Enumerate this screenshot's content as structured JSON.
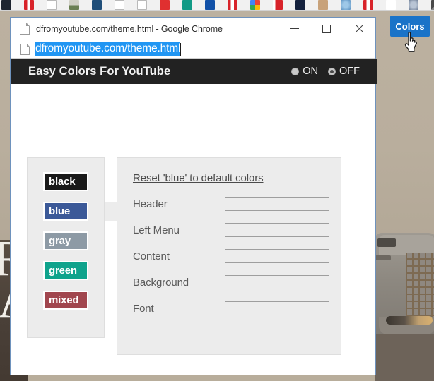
{
  "desktop": {
    "bookmark_favicons": [
      "bookmark-favicon-dark",
      "bookmark-favicon-red-stripes",
      "bookmark-favicon-blank",
      "bookmark-favicon-photo",
      "bookmark-favicon-blue-building",
      "bookmark-favicon-blank-2",
      "bookmark-favicon-blank-3",
      "bookmark-favicon-red-rounded",
      "bookmark-favicon-teal-check",
      "bookmark-favicon-blue-flag",
      "bookmark-favicon-red-stripes-2",
      "bookmark-favicon-google-maps",
      "bookmark-favicon-red-white",
      "bookmark-favicon-navy",
      "bookmark-favicon-hand",
      "bookmark-favicon-blue-circle",
      "bookmark-favicon-red-stripes-3",
      "bookmark-favicon-white-text",
      "bookmark-favicon-globe",
      "bookmark-favicon-bird",
      "bookmark-favicon-brown",
      "bookmark-favicon-black"
    ]
  },
  "browser": {
    "window_title": "dfromyoutube.com/theme.html - Google Chrome",
    "url": "dfromyoutube.com/theme.html",
    "tab_favicon": "page-icon",
    "controls": {
      "minimize": "minimize-icon",
      "maximize": "maximize-icon",
      "close": "close-icon"
    }
  },
  "extension": {
    "title": "Easy Colors For YouTube",
    "power": {
      "on_label": "ON",
      "off_label": "OFF",
      "selected": "OFF"
    },
    "presets": [
      {
        "label": "black",
        "bg": "#1a1a1a",
        "fg": "#ffffff",
        "selected": false
      },
      {
        "label": "blue",
        "bg": "#3b5998",
        "fg": "#ffffff",
        "selected": true
      },
      {
        "label": "gray",
        "bg": "#8d9aa5",
        "fg": "#ffffff",
        "selected": false
      },
      {
        "label": "green",
        "bg": "#0fa38c",
        "fg": "#ffffff",
        "selected": false
      },
      {
        "label": "mixed",
        "bg": "#a1464e",
        "fg": "#ffffff",
        "selected": false
      }
    ],
    "reset_link": "Reset 'blue' to default colors",
    "settings": [
      {
        "label": "Header",
        "color": "#3b5998"
      },
      {
        "label": "Left Menu",
        "color": "#3b5998"
      },
      {
        "label": "Content",
        "color": "#3b5998"
      },
      {
        "label": "Background",
        "color": "#82c4f0"
      },
      {
        "label": "Font",
        "color": "#ffffff"
      }
    ]
  },
  "overlay": {
    "colors_button": "Colors",
    "cursor": "pointing-hand-cursor"
  }
}
